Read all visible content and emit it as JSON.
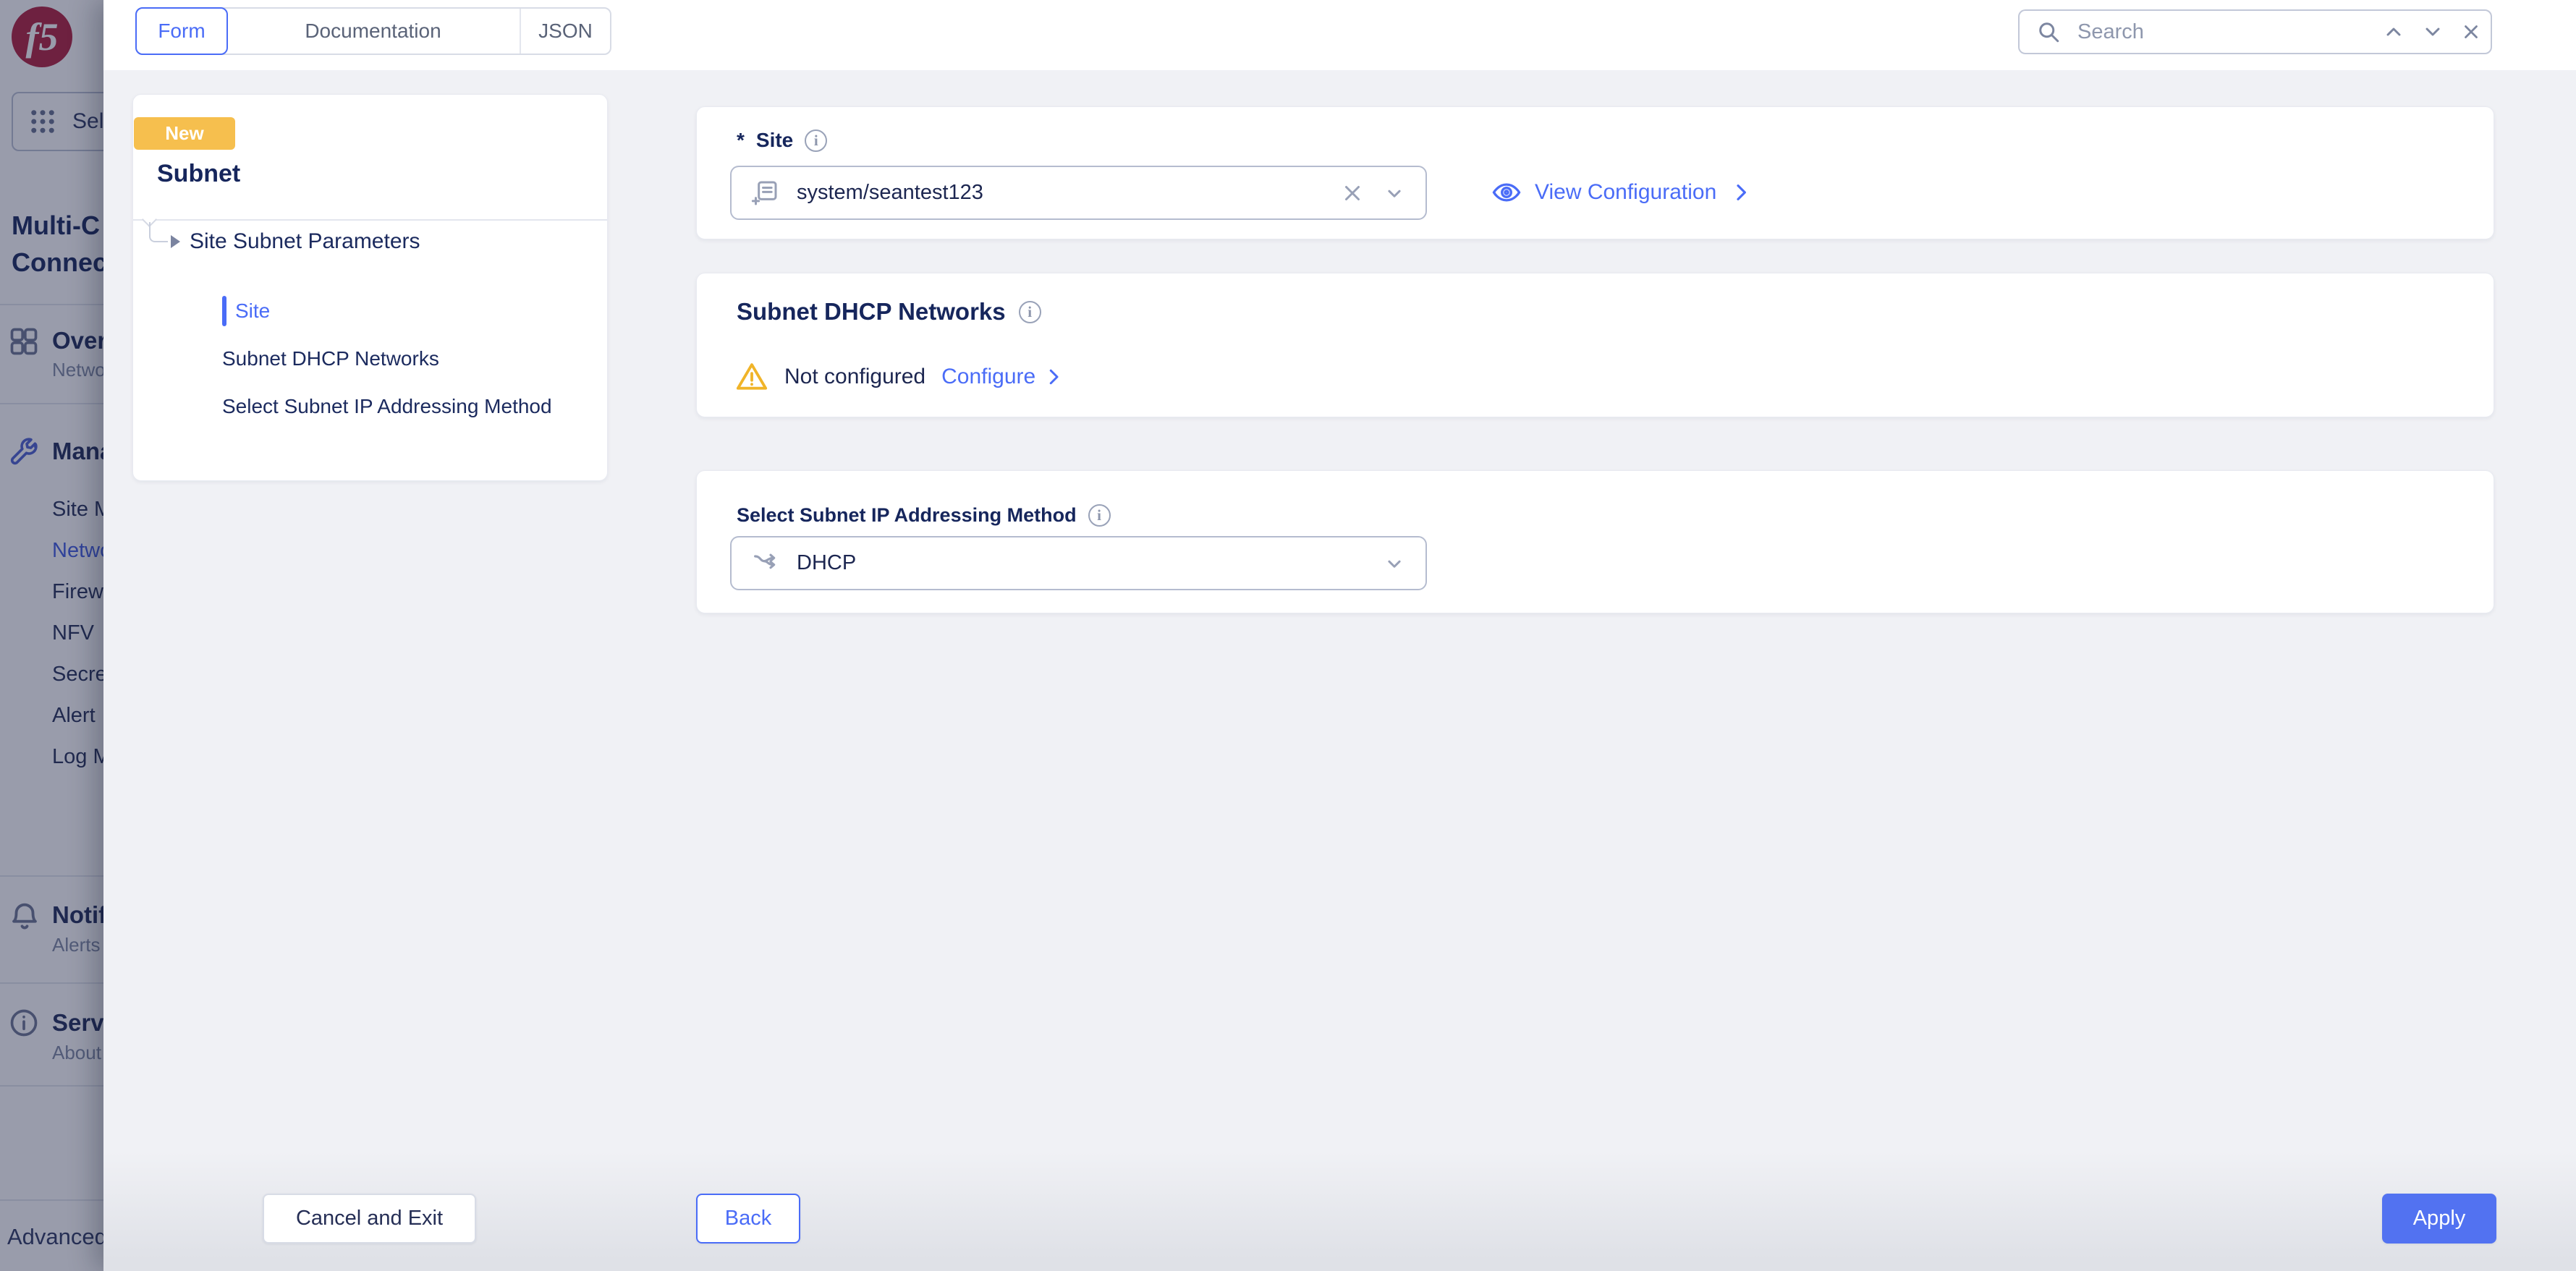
{
  "colors": {
    "accent": "#4a6cf7",
    "apply_button": "#5272f1",
    "new_badge": "#f6bf4e",
    "warning": "#f0b429",
    "heading_navy": "#16265c"
  },
  "chrome": {
    "logo_text": "f5",
    "tabs": [
      {
        "label": "Form",
        "active": true
      },
      {
        "label": "Documentation",
        "active": false
      },
      {
        "label": "JSON",
        "active": false
      }
    ],
    "search": {
      "placeholder": "Search",
      "icons": [
        "search-icon",
        "chevron-up-icon",
        "chevron-down-icon",
        "close-icon"
      ]
    }
  },
  "sidebar": {
    "workspace_button": {
      "label": "Sele",
      "icon": "grid-9-dots-icon"
    },
    "title_lines": {
      "line1": "Multi-C",
      "line2": "Connec"
    },
    "overview": {
      "label": "Overv",
      "sub": "Netwo",
      "icon": "grid-4-icon"
    },
    "manage": {
      "label": "Mana",
      "icon": "wrench-icon",
      "items": [
        {
          "label": "Site M",
          "active": false
        },
        {
          "label": "Netwo",
          "active": true
        },
        {
          "label": "Firew",
          "active": false
        },
        {
          "label": "NFV",
          "active": false
        },
        {
          "label": "Secre",
          "active": false
        },
        {
          "label": "Alert",
          "active": false
        },
        {
          "label": "Log M",
          "active": false
        }
      ]
    },
    "notifications": {
      "label": "Notif",
      "sub": "Alerts",
      "icon": "bell-icon"
    },
    "service": {
      "label": "Servi",
      "sub": "About",
      "icon": "info-circle-icon"
    },
    "footer_label": "Advanced"
  },
  "wizard": {
    "badge": "New",
    "title": "Subnet",
    "tree": {
      "parent": "Site Subnet Parameters",
      "children": [
        {
          "label": "Site",
          "active": true
        },
        {
          "label": "Subnet DHCP Networks",
          "active": false
        },
        {
          "label": "Select Subnet IP Addressing Method",
          "active": false
        }
      ]
    },
    "site_field": {
      "required_mark": "*",
      "label": "Site",
      "value": "system/seantest123",
      "info_glyph": "i"
    },
    "view_configuration": "View Configuration",
    "dhcp_section": {
      "title": "Subnet DHCP Networks",
      "status": "Not configured",
      "action": "Configure",
      "info_glyph": "i"
    },
    "method_field": {
      "label": "Select Subnet IP Addressing Method",
      "value": "DHCP",
      "info_glyph": "i"
    },
    "footer": {
      "cancel": "Cancel and Exit",
      "back": "Back",
      "apply": "Apply"
    }
  }
}
